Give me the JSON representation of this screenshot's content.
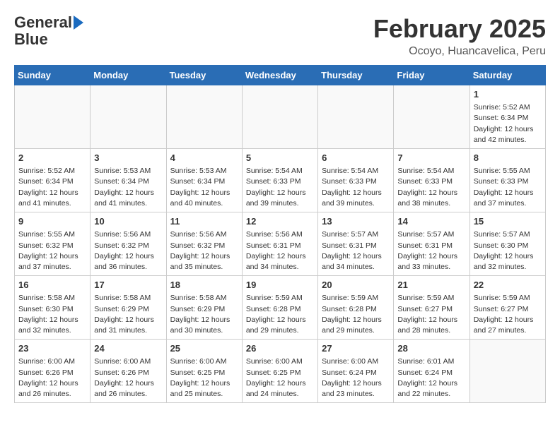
{
  "header": {
    "logo_general": "General",
    "logo_blue": "Blue",
    "month_title": "February 2025",
    "location": "Ocoyo, Huancavelica, Peru"
  },
  "weekdays": [
    "Sunday",
    "Monday",
    "Tuesday",
    "Wednesday",
    "Thursday",
    "Friday",
    "Saturday"
  ],
  "weeks": [
    [
      {
        "day": "",
        "info": ""
      },
      {
        "day": "",
        "info": ""
      },
      {
        "day": "",
        "info": ""
      },
      {
        "day": "",
        "info": ""
      },
      {
        "day": "",
        "info": ""
      },
      {
        "day": "",
        "info": ""
      },
      {
        "day": "1",
        "info": "Sunrise: 5:52 AM\nSunset: 6:34 PM\nDaylight: 12 hours\nand 42 minutes."
      }
    ],
    [
      {
        "day": "2",
        "info": "Sunrise: 5:52 AM\nSunset: 6:34 PM\nDaylight: 12 hours\nand 41 minutes."
      },
      {
        "day": "3",
        "info": "Sunrise: 5:53 AM\nSunset: 6:34 PM\nDaylight: 12 hours\nand 41 minutes."
      },
      {
        "day": "4",
        "info": "Sunrise: 5:53 AM\nSunset: 6:34 PM\nDaylight: 12 hours\nand 40 minutes."
      },
      {
        "day": "5",
        "info": "Sunrise: 5:54 AM\nSunset: 6:33 PM\nDaylight: 12 hours\nand 39 minutes."
      },
      {
        "day": "6",
        "info": "Sunrise: 5:54 AM\nSunset: 6:33 PM\nDaylight: 12 hours\nand 39 minutes."
      },
      {
        "day": "7",
        "info": "Sunrise: 5:54 AM\nSunset: 6:33 PM\nDaylight: 12 hours\nand 38 minutes."
      },
      {
        "day": "8",
        "info": "Sunrise: 5:55 AM\nSunset: 6:33 PM\nDaylight: 12 hours\nand 37 minutes."
      }
    ],
    [
      {
        "day": "9",
        "info": "Sunrise: 5:55 AM\nSunset: 6:32 PM\nDaylight: 12 hours\nand 37 minutes."
      },
      {
        "day": "10",
        "info": "Sunrise: 5:56 AM\nSunset: 6:32 PM\nDaylight: 12 hours\nand 36 minutes."
      },
      {
        "day": "11",
        "info": "Sunrise: 5:56 AM\nSunset: 6:32 PM\nDaylight: 12 hours\nand 35 minutes."
      },
      {
        "day": "12",
        "info": "Sunrise: 5:56 AM\nSunset: 6:31 PM\nDaylight: 12 hours\nand 34 minutes."
      },
      {
        "day": "13",
        "info": "Sunrise: 5:57 AM\nSunset: 6:31 PM\nDaylight: 12 hours\nand 34 minutes."
      },
      {
        "day": "14",
        "info": "Sunrise: 5:57 AM\nSunset: 6:31 PM\nDaylight: 12 hours\nand 33 minutes."
      },
      {
        "day": "15",
        "info": "Sunrise: 5:57 AM\nSunset: 6:30 PM\nDaylight: 12 hours\nand 32 minutes."
      }
    ],
    [
      {
        "day": "16",
        "info": "Sunrise: 5:58 AM\nSunset: 6:30 PM\nDaylight: 12 hours\nand 32 minutes."
      },
      {
        "day": "17",
        "info": "Sunrise: 5:58 AM\nSunset: 6:29 PM\nDaylight: 12 hours\nand 31 minutes."
      },
      {
        "day": "18",
        "info": "Sunrise: 5:58 AM\nSunset: 6:29 PM\nDaylight: 12 hours\nand 30 minutes."
      },
      {
        "day": "19",
        "info": "Sunrise: 5:59 AM\nSunset: 6:28 PM\nDaylight: 12 hours\nand 29 minutes."
      },
      {
        "day": "20",
        "info": "Sunrise: 5:59 AM\nSunset: 6:28 PM\nDaylight: 12 hours\nand 29 minutes."
      },
      {
        "day": "21",
        "info": "Sunrise: 5:59 AM\nSunset: 6:27 PM\nDaylight: 12 hours\nand 28 minutes."
      },
      {
        "day": "22",
        "info": "Sunrise: 5:59 AM\nSunset: 6:27 PM\nDaylight: 12 hours\nand 27 minutes."
      }
    ],
    [
      {
        "day": "23",
        "info": "Sunrise: 6:00 AM\nSunset: 6:26 PM\nDaylight: 12 hours\nand 26 minutes."
      },
      {
        "day": "24",
        "info": "Sunrise: 6:00 AM\nSunset: 6:26 PM\nDaylight: 12 hours\nand 26 minutes."
      },
      {
        "day": "25",
        "info": "Sunrise: 6:00 AM\nSunset: 6:25 PM\nDaylight: 12 hours\nand 25 minutes."
      },
      {
        "day": "26",
        "info": "Sunrise: 6:00 AM\nSunset: 6:25 PM\nDaylight: 12 hours\nand 24 minutes."
      },
      {
        "day": "27",
        "info": "Sunrise: 6:00 AM\nSunset: 6:24 PM\nDaylight: 12 hours\nand 23 minutes."
      },
      {
        "day": "28",
        "info": "Sunrise: 6:01 AM\nSunset: 6:24 PM\nDaylight: 12 hours\nand 22 minutes."
      },
      {
        "day": "",
        "info": ""
      }
    ]
  ]
}
